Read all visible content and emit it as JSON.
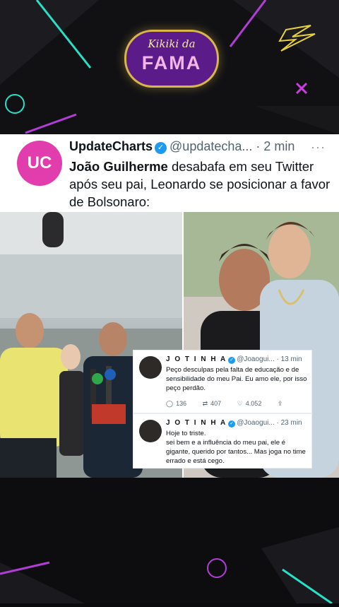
{
  "logo": {
    "top": "Kikiki da",
    "main": "FAMA"
  },
  "tweet": {
    "avatar_text": "UC",
    "name": "UpdateCharts",
    "handle": "@updatecha...",
    "time": "· 2 min",
    "more": "···",
    "text_bold": "João Guilherme",
    "text_rest": " desabafa em seu Twitter após seu pai, Leonardo se posicionar a favor de Bolsonaro:"
  },
  "embedded": [
    {
      "name": "J O T I N H A",
      "handle": "@Joaogui...",
      "time": "· 13 min",
      "body": "Peço desculpas pela falta de educação e de sensibilidade do meu Pai. Eu amo ele, por isso peço perdão.",
      "replies": "136",
      "retweets": "407",
      "likes": "4.052"
    },
    {
      "name": "J O T I N H A",
      "handle": "@Joaogui...",
      "time": "· 23 min",
      "body": "Hoje to triste.\nsei bem e a influência do meu pai, ele é gigante, querido por tantos... Mas joga no time errado e está cego."
    }
  ],
  "colors": {
    "accent": "#e13dac",
    "verified": "#1d9bf0",
    "logo_bg": "#5b1c8a",
    "logo_ring": "#d9b64a"
  }
}
